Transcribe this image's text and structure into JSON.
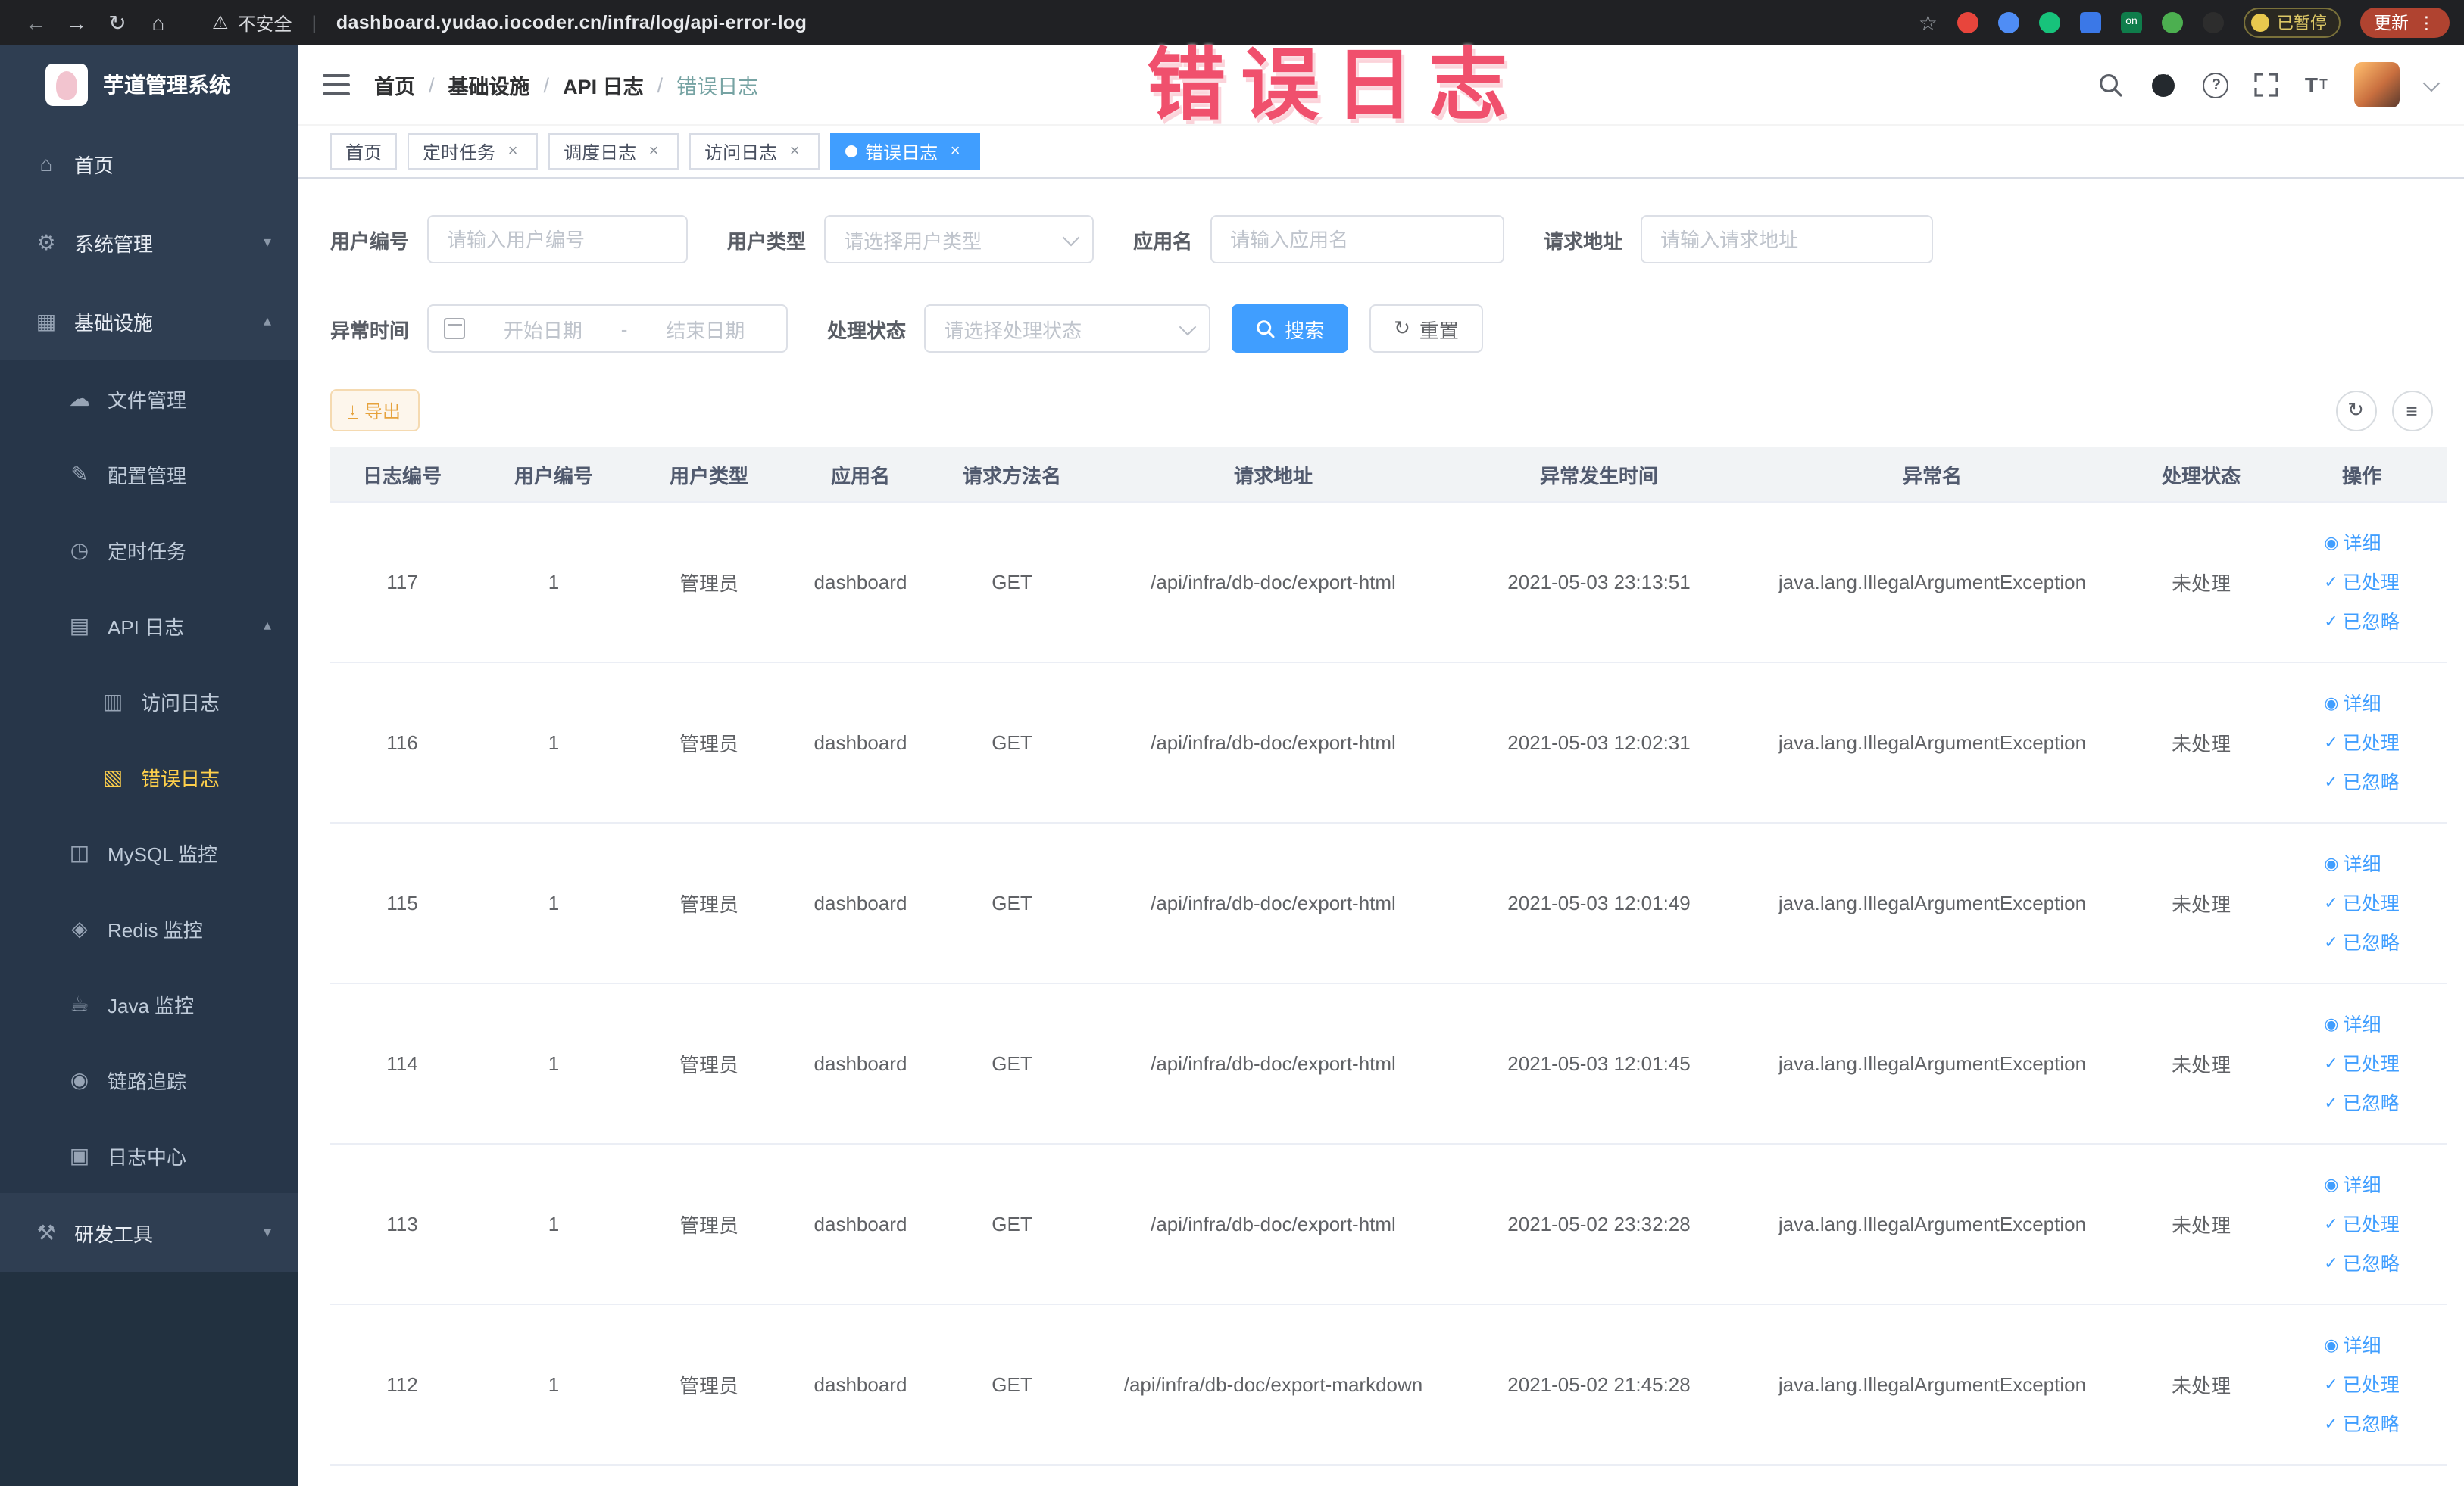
{
  "colors": {
    "accent": "#409eff",
    "menu_active": "#ffd04b",
    "warning": "#e6a23c",
    "annotation": "#f0506d"
  },
  "browser": {
    "back_icon": "←",
    "forward_icon": "→",
    "reload_icon": "↻",
    "home_icon": "⌂",
    "warning_icon": "⚠",
    "security_label": "不安全",
    "divider": "|",
    "url": "dashboard.yudao.iocoder.cn/infra/log/api-error-log",
    "star_icon": "☆",
    "ext_on_label": "on",
    "paused_label": "已暂停",
    "update_label": "更新",
    "kebab_icon": "⋮"
  },
  "annotation": {
    "text": "错误日志"
  },
  "sidebar": {
    "logo_title": "芋道管理系统",
    "items": [
      {
        "icon": "⌂",
        "label": "首页"
      },
      {
        "icon": "⚙",
        "label": "系统管理",
        "chevron": "▾"
      },
      {
        "icon": "▦",
        "label": "基础设施",
        "chevron": "▴"
      },
      {
        "icon": "☁",
        "label": "文件管理"
      },
      {
        "icon": "✎",
        "label": "配置管理"
      },
      {
        "icon": "◷",
        "label": "定时任务"
      },
      {
        "icon": "▤",
        "label": "API 日志",
        "chevron": "▴"
      },
      {
        "icon": "▥",
        "label": "访问日志"
      },
      {
        "icon": "▧",
        "label": "错误日志"
      },
      {
        "icon": "◫",
        "label": "MySQL 监控"
      },
      {
        "icon": "◈",
        "label": "Redis 监控"
      },
      {
        "icon": "☕",
        "label": "Java 监控"
      },
      {
        "icon": "◉",
        "label": "链路追踪"
      },
      {
        "icon": "▣",
        "label": "日志中心"
      },
      {
        "icon": "⚒",
        "label": "研发工具",
        "chevron": "▾"
      }
    ]
  },
  "header": {
    "breadcrumb": {
      "b0": "首页",
      "b1": "基础设施",
      "b2": "API 日志",
      "b3": "错误日志",
      "sep": "/"
    },
    "help_icon": "?",
    "fontsize_big": "T",
    "fontsize_small": "T"
  },
  "tabs": [
    {
      "label": "首页"
    },
    {
      "label": "定时任务",
      "close": "×"
    },
    {
      "label": "调度日志",
      "close": "×"
    },
    {
      "label": "访问日志",
      "close": "×"
    },
    {
      "label": "错误日志",
      "close": "×",
      "dot": "●"
    }
  ],
  "filters": {
    "user_id_label": "用户编号",
    "user_id_placeholder": "请输入用户编号",
    "user_type_label": "用户类型",
    "user_type_placeholder": "请选择用户类型",
    "app_name_label": "应用名",
    "app_name_placeholder": "请输入应用名",
    "request_url_label": "请求地址",
    "request_url_placeholder": "请输入请求地址",
    "exception_time_label": "异常时间",
    "date_start_placeholder": "开始日期",
    "date_separator": "-",
    "date_end_placeholder": "结束日期",
    "process_status_label": "处理状态",
    "process_status_placeholder": "请选择处理状态",
    "search_label": "搜索",
    "reset_label": "重置",
    "reset_icon": "↻"
  },
  "toolbar": {
    "export_label": "导出",
    "export_icon": "↓",
    "refresh_icon": "↻",
    "columns_icon": "≡"
  },
  "table": {
    "columns": [
      "日志编号",
      "用户编号",
      "用户类型",
      "应用名",
      "请求方法名",
      "请求地址",
      "异常发生时间",
      "异常名",
      "处理状态",
      "操作"
    ],
    "detail_icon": "◉",
    "check_icon": "✓",
    "action_detail": "详细",
    "action_processed": "已处理",
    "action_ignored": "已忽略",
    "rows": [
      {
        "id": "117",
        "user_id": "1",
        "user_type": "管理员",
        "app": "dashboard",
        "method": "GET",
        "url": "/api/infra/db-doc/export-html",
        "time": "2021-05-03 23:13:51",
        "exception": "java.lang.IllegalArgumentException",
        "status": "未处理"
      },
      {
        "id": "116",
        "user_id": "1",
        "user_type": "管理员",
        "app": "dashboard",
        "method": "GET",
        "url": "/api/infra/db-doc/export-html",
        "time": "2021-05-03 12:02:31",
        "exception": "java.lang.IllegalArgumentException",
        "status": "未处理"
      },
      {
        "id": "115",
        "user_id": "1",
        "user_type": "管理员",
        "app": "dashboard",
        "method": "GET",
        "url": "/api/infra/db-doc/export-html",
        "time": "2021-05-03 12:01:49",
        "exception": "java.lang.IllegalArgumentException",
        "status": "未处理"
      },
      {
        "id": "114",
        "user_id": "1",
        "user_type": "管理员",
        "app": "dashboard",
        "method": "GET",
        "url": "/api/infra/db-doc/export-html",
        "time": "2021-05-03 12:01:45",
        "exception": "java.lang.IllegalArgumentException",
        "status": "未处理"
      },
      {
        "id": "113",
        "user_id": "1",
        "user_type": "管理员",
        "app": "dashboard",
        "method": "GET",
        "url": "/api/infra/db-doc/export-html",
        "time": "2021-05-02 23:32:28",
        "exception": "java.lang.IllegalArgumentException",
        "status": "未处理"
      },
      {
        "id": "112",
        "user_id": "1",
        "user_type": "管理员",
        "app": "dashboard",
        "method": "GET",
        "url": "/api/infra/db-doc/export-markdown",
        "time": "2021-05-02 21:45:28",
        "exception": "java.lang.IllegalArgumentException",
        "status": "未处理"
      }
    ]
  }
}
